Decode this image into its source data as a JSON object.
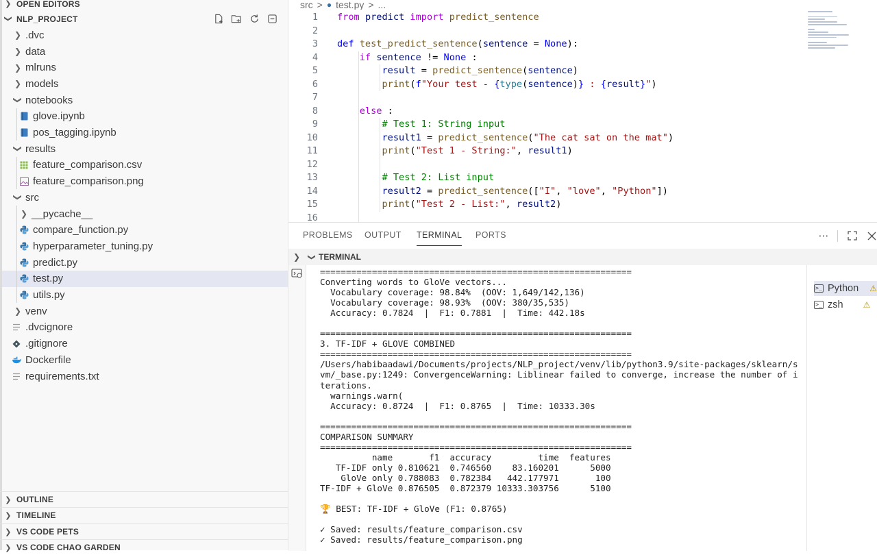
{
  "sidebar": {
    "open_editors": "OPEN EDITORS",
    "project": "NLP_PROJECT",
    "tree": [
      {
        "label": ".dvc",
        "type": "folder",
        "depth": 0,
        "open": false
      },
      {
        "label": "data",
        "type": "folder",
        "depth": 0,
        "open": false
      },
      {
        "label": "mlruns",
        "type": "folder",
        "depth": 0,
        "open": false
      },
      {
        "label": "models",
        "type": "folder",
        "depth": 0,
        "open": false
      },
      {
        "label": "notebooks",
        "type": "folder",
        "depth": 0,
        "open": true
      },
      {
        "label": "glove.ipynb",
        "type": "notebook",
        "depth": 1
      },
      {
        "label": "pos_tagging.ipynb",
        "type": "notebook",
        "depth": 1
      },
      {
        "label": "results",
        "type": "folder",
        "depth": 0,
        "open": true
      },
      {
        "label": "feature_comparison.csv",
        "type": "csv",
        "depth": 1
      },
      {
        "label": "feature_comparison.png",
        "type": "image",
        "depth": 1
      },
      {
        "label": "src",
        "type": "folder",
        "depth": 0,
        "open": true
      },
      {
        "label": "__pycache__",
        "type": "folder",
        "depth": 1,
        "open": false
      },
      {
        "label": "compare_function.py",
        "type": "python",
        "depth": 1
      },
      {
        "label": "hyperparameter_tuning.py",
        "type": "python",
        "depth": 1
      },
      {
        "label": "predict.py",
        "type": "python",
        "depth": 1
      },
      {
        "label": "test.py",
        "type": "python",
        "depth": 1,
        "selected": true
      },
      {
        "label": "utils.py",
        "type": "python",
        "depth": 1
      },
      {
        "label": "venv",
        "type": "folder",
        "depth": 0,
        "open": false
      },
      {
        "label": ".dvcignore",
        "type": "text",
        "depth": 0
      },
      {
        "label": ".gitignore",
        "type": "git",
        "depth": 0
      },
      {
        "label": "Dockerfile",
        "type": "docker",
        "depth": 0
      },
      {
        "label": "requirements.txt",
        "type": "text",
        "depth": 0
      }
    ],
    "bottom_sections": [
      "OUTLINE",
      "TIMELINE",
      "VS CODE PETS",
      "VS CODE CHAO GARDEN"
    ]
  },
  "breadcrumb": [
    "src",
    ">",
    "test.py",
    ">",
    "..."
  ],
  "editor": {
    "lines": [
      [
        [
          "kw2",
          "from"
        ],
        [
          "plain",
          " "
        ],
        [
          "var",
          "predict"
        ],
        [
          "plain",
          " "
        ],
        [
          "kw2",
          "import"
        ],
        [
          "plain",
          " "
        ],
        [
          "fn",
          "predict_sentence"
        ]
      ],
      [],
      [
        [
          "kw",
          "def"
        ],
        [
          "plain",
          " "
        ],
        [
          "fn",
          "test_predict_sentence"
        ],
        [
          "plain",
          "("
        ],
        [
          "var",
          "sentence"
        ],
        [
          "plain",
          " = "
        ],
        [
          "kw",
          "None"
        ],
        [
          "plain",
          "):"
        ]
      ],
      [
        [
          "plain",
          "    "
        ],
        [
          "kw2",
          "if"
        ],
        [
          "plain",
          " "
        ],
        [
          "var",
          "sentence"
        ],
        [
          "plain",
          " != "
        ],
        [
          "kw",
          "None"
        ],
        [
          "plain",
          " :"
        ]
      ],
      [
        [
          "plain",
          "        "
        ],
        [
          "var",
          "result"
        ],
        [
          "plain",
          " = "
        ],
        [
          "fn",
          "predict_sentence"
        ],
        [
          "plain",
          "("
        ],
        [
          "var",
          "sentence"
        ],
        [
          "plain",
          ")"
        ]
      ],
      [
        [
          "plain",
          "        "
        ],
        [
          "fn",
          "print"
        ],
        [
          "plain",
          "("
        ],
        [
          "kw",
          "f"
        ],
        [
          "str",
          "\"Your test - "
        ],
        [
          "kw",
          "{"
        ],
        [
          "ty",
          "type"
        ],
        [
          "plain",
          "("
        ],
        [
          "var",
          "sentence"
        ],
        [
          "plain",
          ")"
        ],
        [
          "kw",
          "}"
        ],
        [
          "str",
          " : "
        ],
        [
          "kw",
          "{"
        ],
        [
          "var",
          "result"
        ],
        [
          "kw",
          "}"
        ],
        [
          "str",
          "\""
        ],
        [
          "plain",
          ")"
        ]
      ],
      [],
      [
        [
          "plain",
          "    "
        ],
        [
          "kw2",
          "else"
        ],
        [
          "plain",
          " :"
        ]
      ],
      [
        [
          "plain",
          "        "
        ],
        [
          "cmt",
          "# Test 1: String input"
        ]
      ],
      [
        [
          "plain",
          "        "
        ],
        [
          "var",
          "result1"
        ],
        [
          "plain",
          " = "
        ],
        [
          "fn",
          "predict_sentence"
        ],
        [
          "plain",
          "("
        ],
        [
          "str",
          "\"The cat sat on the mat\""
        ],
        [
          "plain",
          ")"
        ]
      ],
      [
        [
          "plain",
          "        "
        ],
        [
          "fn",
          "print"
        ],
        [
          "plain",
          "("
        ],
        [
          "str",
          "\"Test 1 - String:\""
        ],
        [
          "plain",
          ", "
        ],
        [
          "var",
          "result1"
        ],
        [
          "plain",
          ")"
        ]
      ],
      [],
      [
        [
          "plain",
          "        "
        ],
        [
          "cmt",
          "# Test 2: List input"
        ]
      ],
      [
        [
          "plain",
          "        "
        ],
        [
          "var",
          "result2"
        ],
        [
          "plain",
          " = "
        ],
        [
          "fn",
          "predict_sentence"
        ],
        [
          "plain",
          "(["
        ],
        [
          "str",
          "\"I\""
        ],
        [
          "plain",
          ", "
        ],
        [
          "str",
          "\"love\""
        ],
        [
          "plain",
          ", "
        ],
        [
          "str",
          "\"Python\""
        ],
        [
          "plain",
          "])"
        ]
      ],
      [
        [
          "plain",
          "        "
        ],
        [
          "fn",
          "print"
        ],
        [
          "plain",
          "("
        ],
        [
          "str",
          "\"Test 2 - List:\""
        ],
        [
          "plain",
          ", "
        ],
        [
          "var",
          "result2"
        ],
        [
          "plain",
          ")"
        ]
      ],
      []
    ]
  },
  "panel": {
    "tabs": [
      "PROBLEMS",
      "OUTPUT",
      "TERMINAL",
      "PORTS"
    ],
    "active_tab": "TERMINAL",
    "terminal_header": "TERMINAL",
    "terminals": [
      {
        "label": "Python",
        "active": true
      },
      {
        "label": "zsh",
        "active": false
      }
    ],
    "output": [
      "============================================================",
      "Converting words to GloVe vectors...",
      "  Vocabulary coverage: 98.84%  (OOV: 1,649/142,136)",
      "  Vocabulary coverage: 98.93%  (OOV: 380/35,535)",
      "  Accuracy: 0.7824  |  F1: 0.7881  |  Time: 442.18s",
      "",
      "============================================================",
      "3. TF-IDF + GLOVE COMBINED",
      "============================================================",
      "/Users/habibaadawi/Documents/projects/NLP_project/venv/lib/python3.9/site-packages/sklearn/s",
      "vm/_base.py:1249: ConvergenceWarning: Liblinear failed to converge, increase the number of i",
      "terations.",
      "  warnings.warn(",
      "  Accuracy: 0.8724  |  F1: 0.8765  |  Time: 10333.30s",
      "",
      "============================================================",
      "COMPARISON SUMMARY",
      "============================================================",
      "          name       f1  accuracy         time  features",
      "   TF-IDF only 0.810621  0.746560    83.160201      5000",
      "    GloVe only 0.788083  0.782384   442.177971       100",
      "TF-IDF + GloVe 0.876505  0.872379 10333.303756      5100",
      "",
      "🏆 BEST: TF-IDF + GloVe (F1: 0.8765)",
      "",
      "✓ Saved: results/feature_comparison.csv",
      "✓ Saved: results/feature_comparison.png"
    ]
  }
}
